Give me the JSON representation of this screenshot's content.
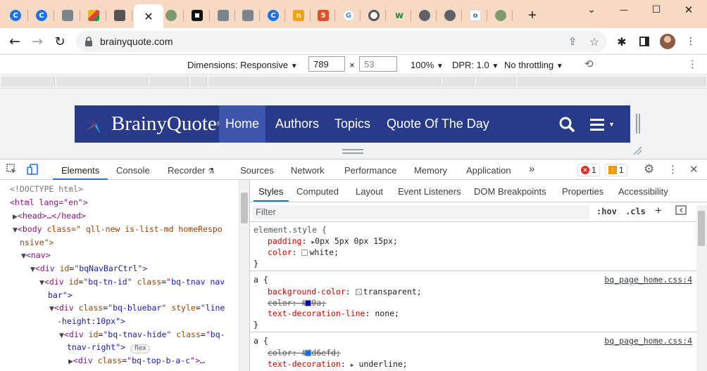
{
  "browser": {
    "tabs": [
      {
        "icon": "chrome-icon"
      },
      {
        "icon": "chrome-icon"
      },
      {
        "icon": "tab-avatar-icon"
      },
      {
        "icon": "tab-paint-icon"
      },
      {
        "icon": "tab-logo-icon"
      },
      {
        "icon": "tab-profile-icon"
      },
      {
        "icon": "tab-qr-icon"
      },
      {
        "icon": "tab-avatar-icon"
      },
      {
        "icon": "tab-avatar-icon"
      },
      {
        "icon": "chrome-icon"
      },
      {
        "icon": "tab-n-icon",
        "letter": "n"
      },
      {
        "icon": "html5-icon",
        "letter": "5"
      },
      {
        "icon": "google-icon",
        "letter": "G"
      },
      {
        "icon": "chromium-icon"
      },
      {
        "icon": "tab-w-icon",
        "letter": "w"
      },
      {
        "icon": "globe-icon"
      },
      {
        "icon": "globe-icon"
      },
      {
        "icon": "tab-o-icon",
        "letter": "o"
      },
      {
        "icon": "tab-profile-icon"
      }
    ],
    "active_tab_close": "✕",
    "new_tab": "+",
    "window_controls": {
      "chevron": "⌄",
      "minimize": "—",
      "maximize": "☐",
      "close": "✕"
    },
    "url": "brainyquote.com"
  },
  "device_toolbar": {
    "dimensions_label": "Dimensions: Responsive",
    "width": "789",
    "times": "×",
    "height_placeholder": "53",
    "zoom": "100%",
    "dpr": "DPR: 1.0",
    "throttling": "No throttling"
  },
  "page": {
    "logo_text": "BrainyQuote",
    "logo_reg": "®",
    "nav": [
      "Home",
      "Authors",
      "Topics",
      "Quote Of The Day"
    ]
  },
  "devtools": {
    "tabs": [
      "Elements",
      "Console",
      "Recorder",
      "Sources",
      "Network",
      "Performance",
      "Memory",
      "Application",
      "»"
    ],
    "errors": "1",
    "warnings": "1",
    "dom_lines": {
      "doctype": "<!DOCTYPE html>",
      "html_open": "<html lang=\"en\">",
      "head": "<head>…</head>",
      "body_l1": "class=\" qll-new is-list-md homeRespo",
      "body_l2": "nsive\">",
      "nav": "<nav>",
      "div1": "bqNavBarCtrl",
      "div2_id": "bq-tn-id",
      "div2_class": "bq-tnav nav",
      "div2_l2": "bar\">",
      "div3_class": "bq-bluebar",
      "div3_style": "line",
      "div3_l2": "-height:10px\">",
      "div4_id": "bq-tnav-hide",
      "div4_class": "bq-",
      "div4_l2": "tnav-right\">",
      "flex": "flex",
      "div5_class": "bq-top-b-a-c"
    },
    "style_tabs": [
      "Styles",
      "Computed",
      "Layout",
      "Event Listeners",
      "DOM Breakpoints",
      "Properties",
      "Accessibility"
    ],
    "filter_placeholder": "Filter",
    "hov": ":hov",
    "cls": ".cls",
    "rules": {
      "r1_selector": "element.style {",
      "r1_p1_name": "padding",
      "r1_p1_value": "0px 5px 0px 15px;",
      "r1_p2_name": "color",
      "r1_p2_value": "white;",
      "close": "}",
      "r2_selector": "a {",
      "r2_source": "bq_page_home.css:4",
      "r2_p1_name": "background-color",
      "r2_p1_value": "transparent;",
      "r2_p2": "color: #00a;",
      "r2_p3_name": "text-decoration-line",
      "r2_p3_value": "none;",
      "r3_selector": "a {",
      "r3_source": "bq_page_home.css:4",
      "r3_p1": "color: #0d6efd;",
      "r3_p2_name": "text-decoration",
      "r3_p2_value": "underline;"
    }
  },
  "colors": {
    "tabstrip": "#f7d9c4",
    "bq_nav": "#293a8a",
    "bq_active": "#3e55ad",
    "accent": "#1a73e8",
    "swatch_00a": "#0000aa",
    "swatch_0d6efd": "#0d6efd"
  }
}
